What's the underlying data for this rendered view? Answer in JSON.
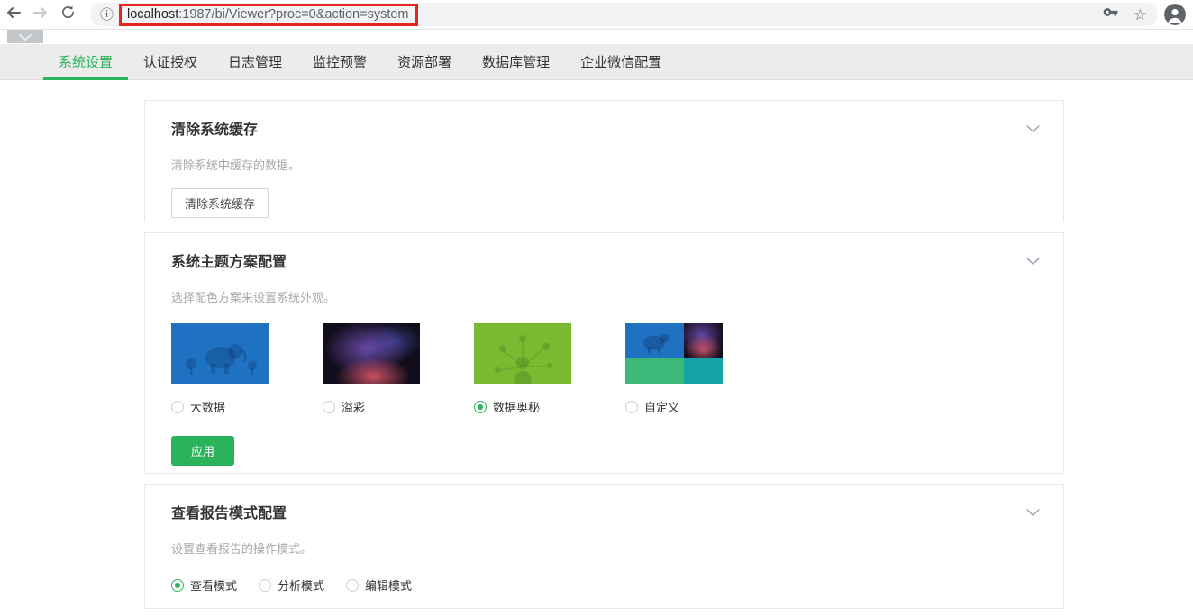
{
  "colors": {
    "accent": "#2bb35c",
    "url_highlight": "#e8251d"
  },
  "browser": {
    "back_icon": "back-arrow",
    "forward_icon": "forward-arrow",
    "refresh_icon": "refresh",
    "info_icon": "ⓘ",
    "star_icon": "☆",
    "url": {
      "host": "localhost",
      "rest": ":1987/bi/Viewer?proc=0&action=system"
    }
  },
  "nav": {
    "tabs": [
      {
        "label": "系统设置",
        "active": true
      },
      {
        "label": "认证授权",
        "active": false
      },
      {
        "label": "日志管理",
        "active": false
      },
      {
        "label": "监控预警",
        "active": false
      },
      {
        "label": "资源部署",
        "active": false
      },
      {
        "label": "数据库管理",
        "active": false
      },
      {
        "label": "企业微信配置",
        "active": false
      }
    ]
  },
  "cards": {
    "cache": {
      "title": "清除系统缓存",
      "description": "清除系统中缓存的数据。",
      "button_label": "清除系统缓存"
    },
    "theme": {
      "title": "系统主题方案配置",
      "description": "选择配色方案来设置系统外观。",
      "options": [
        {
          "label": "大数据",
          "selected": false,
          "preview_color": "#1e72c1"
        },
        {
          "label": "溢彩",
          "selected": false,
          "preview_color": "#120d1a"
        },
        {
          "label": "数据奥秘",
          "selected": true,
          "preview_color": "#7ab930"
        },
        {
          "label": "自定义",
          "selected": false,
          "preview_color": "#3cb878"
        }
      ],
      "apply_label": "应用"
    },
    "report_mode": {
      "title": "查看报告模式配置",
      "description": "设置查看报告的操作模式。",
      "options": [
        {
          "label": "查看模式",
          "selected": true
        },
        {
          "label": "分析模式",
          "selected": false
        },
        {
          "label": "编辑模式",
          "selected": false
        }
      ]
    }
  }
}
